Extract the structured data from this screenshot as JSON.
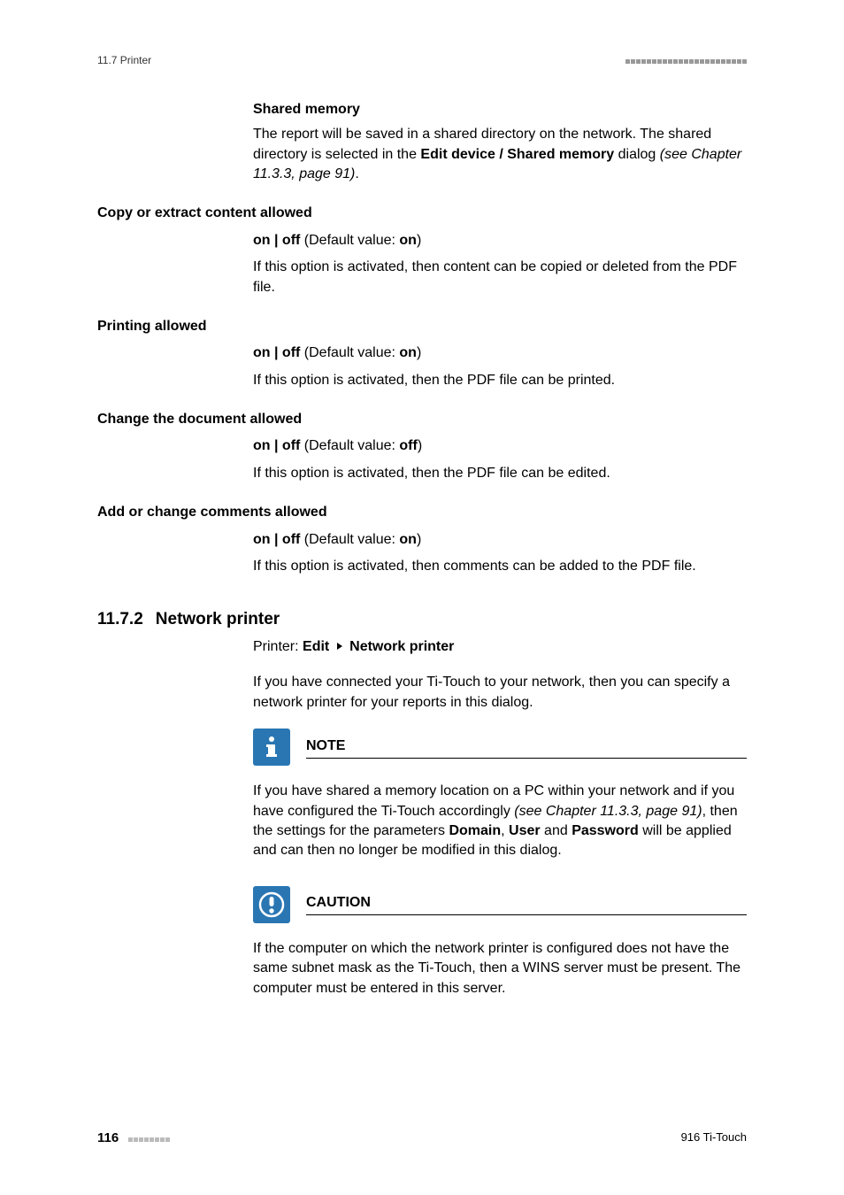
{
  "header": {
    "left": "11.7 Printer"
  },
  "sharedMemory": {
    "label": "Shared memory",
    "body1a": "The report will be saved in a shared directory on the network. The shared directory is selected in the ",
    "body1b": "Edit device / Shared memory",
    "body1c": " dialog ",
    "body1d": "(see Chapter 11.3.3, page 91)",
    "body1e": "."
  },
  "opts": {
    "copy": {
      "title": "Copy or extract content allowed",
      "def_a": "on | off",
      "def_b": " (Default value: ",
      "def_c": "on",
      "def_d": ")",
      "desc": "If this option is activated, then content can be copied or deleted from the PDF file."
    },
    "print": {
      "title": "Printing allowed",
      "def_a": "on | off",
      "def_b": " (Default value: ",
      "def_c": "on",
      "def_d": ")",
      "desc": "If this option is activated, then the PDF file can be printed."
    },
    "change": {
      "title": "Change the document allowed",
      "def_a": "on | off",
      "def_b": " (Default value: ",
      "def_c": "off",
      "def_d": ")",
      "desc": "If this option is activated, then the PDF file can be edited."
    },
    "comments": {
      "title": "Add or change comments allowed",
      "def_a": "on | off",
      "def_b": " (Default value: ",
      "def_c": "on",
      "def_d": ")",
      "desc": "If this option is activated, then comments can be added to the PDF file."
    }
  },
  "section": {
    "num": "11.7.2",
    "title": "Network printer",
    "crumb1": "Printer: ",
    "crumb2": "Edit",
    "crumb3": "Network printer",
    "intro": "If you have connected your Ti-Touch to your network, then you can specify a network printer for your reports in this dialog."
  },
  "note": {
    "label": "NOTE",
    "b1a": "If you have shared a memory location on a PC within your network and if you have configured the Ti-Touch accordingly ",
    "b1b": "(see Chapter 11.3.3, page 91)",
    "b1c": ", then the settings for the parameters ",
    "b1d": "Domain",
    "b1e": ", ",
    "b1f": "User",
    "b1g": " and ",
    "b1h": "Password",
    "b1i": " will be applied and can then no longer be modified in this dialog."
  },
  "caution": {
    "label": "CAUTION",
    "body": "If the computer on which the network printer is configured does not have the same subnet mask as the Ti-Touch, then a WINS server must be present. The computer must be entered in this server."
  },
  "footer": {
    "page": "116",
    "title": "916 Ti-Touch"
  }
}
